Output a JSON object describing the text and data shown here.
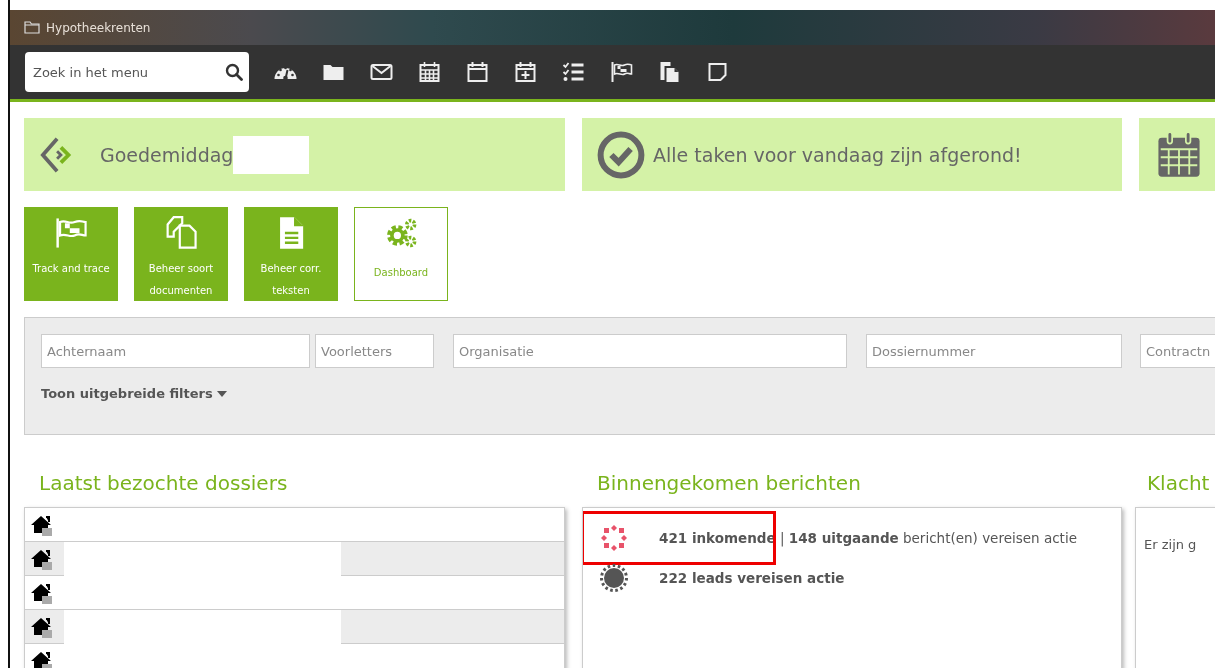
{
  "window": {
    "title": "Hypotheekrenten"
  },
  "toolbar": {
    "search": {
      "placeholder": "Zoek in het menu"
    }
  },
  "banners": [
    {
      "kind": "greeting",
      "text": "Goedemiddag"
    },
    {
      "kind": "tasks",
      "text": "Alle taken voor vandaag zijn afgerond!"
    },
    {
      "kind": "calendar"
    }
  ],
  "tiles": [
    {
      "kind": "flag",
      "label": "Track and trace",
      "selected": false
    },
    {
      "kind": "documents",
      "label": "Beheer soort documenten",
      "selected": false
    },
    {
      "kind": "file",
      "label": "Beheer corr. teksten",
      "selected": false
    },
    {
      "kind": "gears",
      "label": "Dashboard",
      "selected": true
    }
  ],
  "filters": {
    "fields": [
      {
        "placeholder": "Achternaam"
      },
      {
        "placeholder": "Voorletters"
      },
      {
        "placeholder": "Organisatie"
      },
      {
        "placeholder": "Dossiernummer"
      },
      {
        "placeholder": "Contractn"
      }
    ],
    "toggle": "Toon uitgebreide filters"
  },
  "recent": {
    "title": "Laatst bezochte dossiers"
  },
  "messages": {
    "title": "Binnengekomen berichten",
    "items": [
      {
        "kind": "incoming",
        "text": "**421 inkomende** | **148 uitgaande** bericht(en) vereisen actie",
        "highlighted": true
      },
      {
        "kind": "leads",
        "text": "**222 leads vereisen actie**",
        "highlighted": false
      }
    ]
  },
  "complaints": {
    "title": "Klacht",
    "text": "Er zijn g"
  }
}
